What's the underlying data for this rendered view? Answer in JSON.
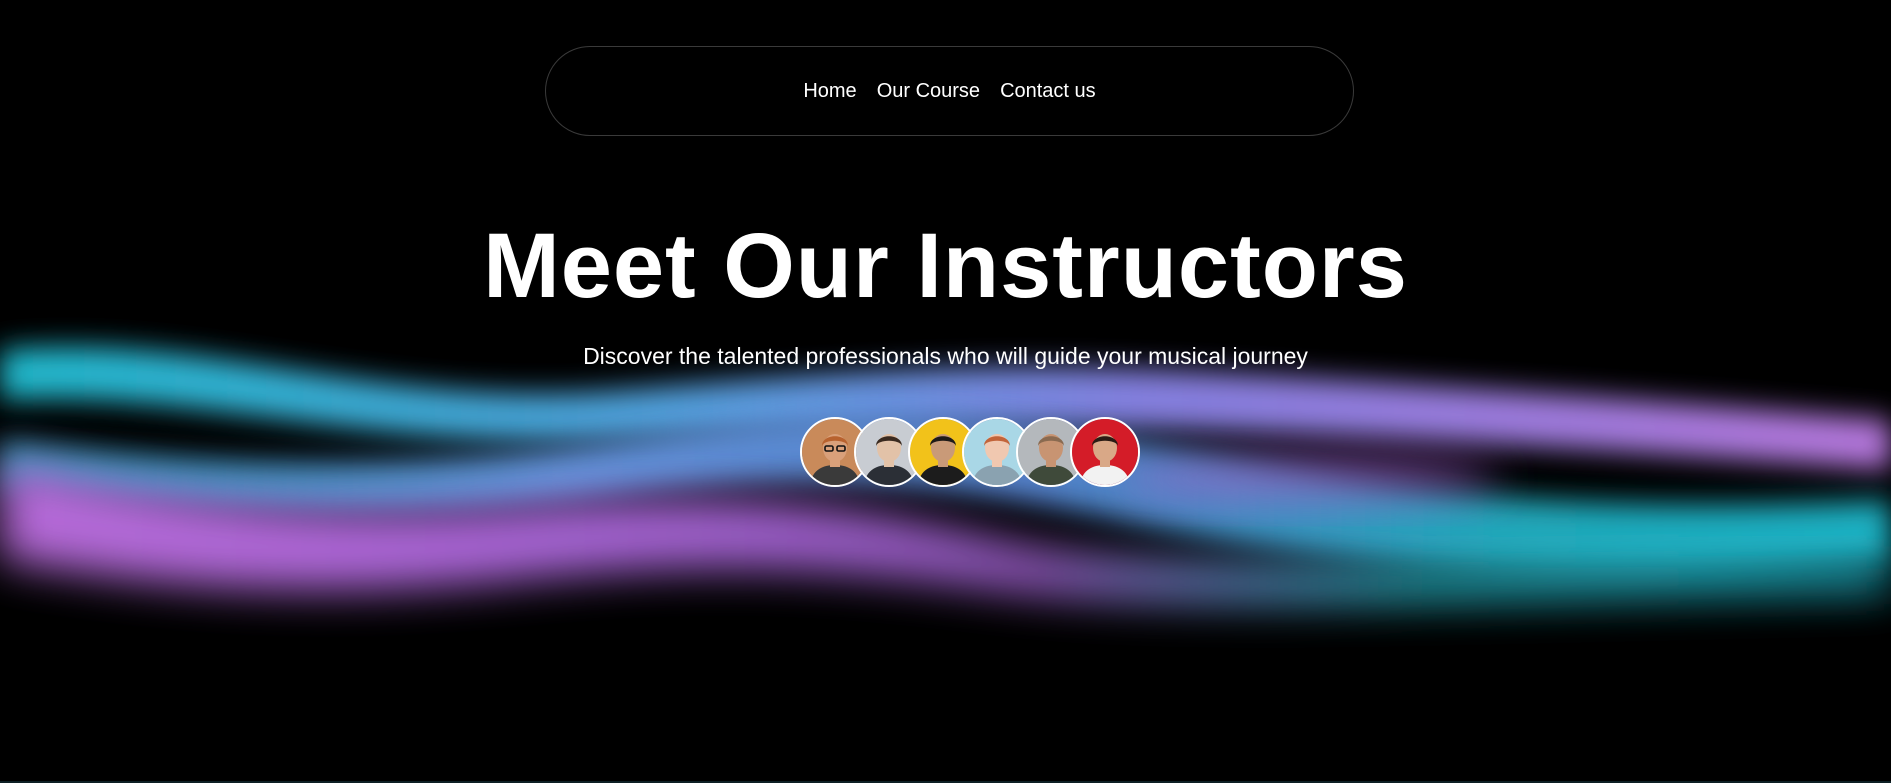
{
  "nav": {
    "items": [
      "Home",
      "Our Course",
      "Contact us"
    ]
  },
  "hero": {
    "title": "Meet Our Instructors",
    "subtitle": "Discover the talented professionals who will guide your musical journey"
  },
  "instructors": {
    "avatars": [
      {
        "bg": "#c98a5a",
        "skin": "#d9a07a",
        "hair": "#b8622e",
        "shirt": "#3a3a3a",
        "glasses": true
      },
      {
        "bg": "#c8ccd2",
        "skin": "#e2c2a8",
        "hair": "#3a2a20",
        "shirt": "#2b2f36",
        "glasses": false
      },
      {
        "bg": "#f2c21a",
        "skin": "#c99a78",
        "hair": "#1e1a18",
        "shirt": "#1c1c1c",
        "glasses": false
      },
      {
        "bg": "#a9d7e6",
        "skin": "#f0c8b0",
        "hair": "#c2643a",
        "shirt": "#8aa2b0",
        "glasses": false
      },
      {
        "bg": "#b4b8bc",
        "skin": "#c89472",
        "hair": "#8a6a50",
        "shirt": "#3f4a3a",
        "glasses": false
      },
      {
        "bg": "#d41c28",
        "skin": "#d9a887",
        "hair": "#2a1a14",
        "shirt": "#f2f2f2",
        "glasses": false
      }
    ]
  },
  "colors": {
    "background": "#000000",
    "wave_cyan": "#22c4d8",
    "wave_blue": "#6c8ee8",
    "wave_violet": "#b77ce8",
    "wave_pink": "#c66cd6"
  }
}
